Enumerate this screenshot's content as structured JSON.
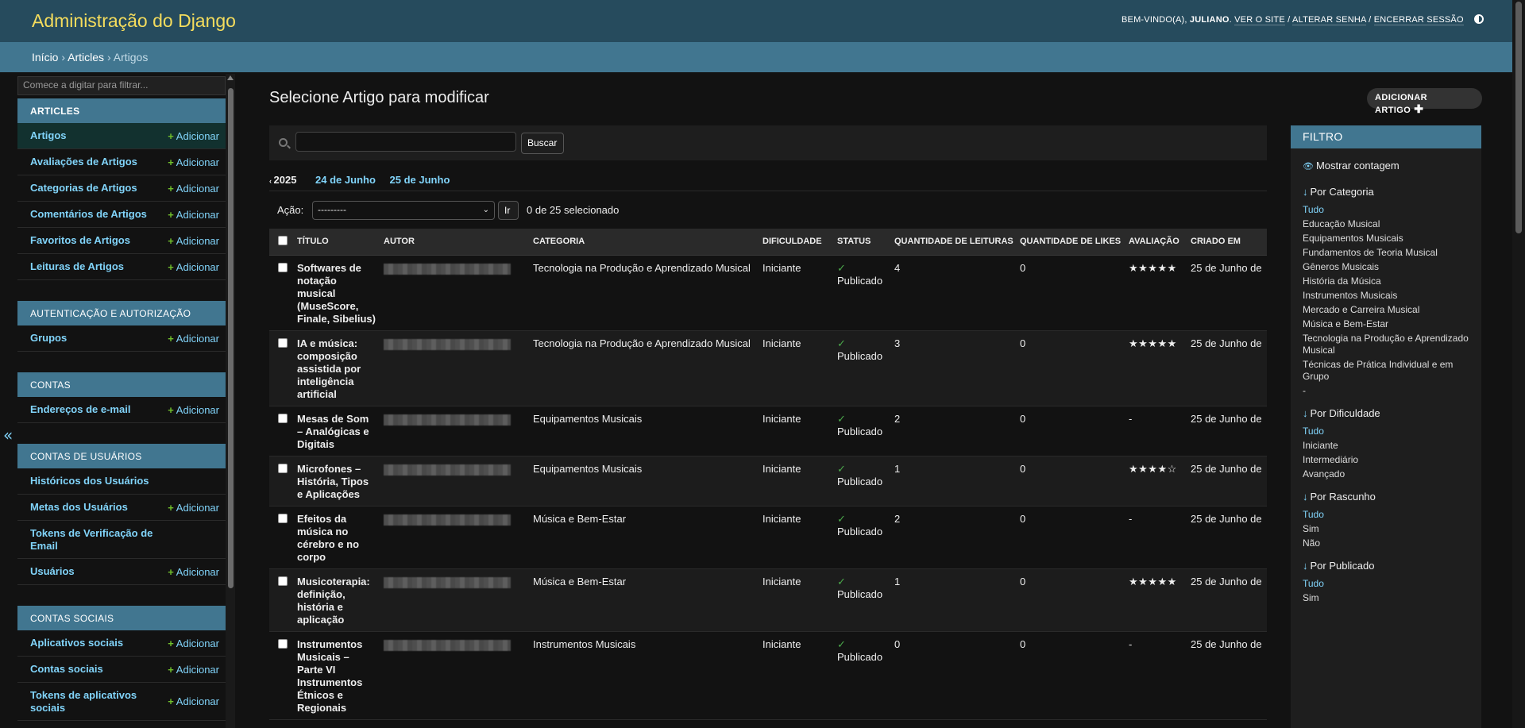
{
  "header": {
    "site_name": "Administração do Django",
    "welcome": "BEM-VINDO(A),",
    "username": "JULIANO",
    "links": [
      "VER O SITE",
      "ALTERAR SENHA",
      "ENCERRAR SESSÃO"
    ]
  },
  "breadcrumbs": {
    "home": "Início",
    "app": "Articles",
    "current": "Artigos",
    "separator": "›"
  },
  "sidebar": {
    "filter_placeholder": "Comece a digitar para filtrar...",
    "add_label": "Adicionar",
    "toggle": "«",
    "apps": [
      {
        "caption": "ARTICLES",
        "models": [
          {
            "name": "Artigos",
            "add": true
          },
          {
            "name": "Avaliações de Artigos",
            "add": true
          },
          {
            "name": "Categorias de Artigos",
            "add": true
          },
          {
            "name": "Comentários de Artigos",
            "add": true
          },
          {
            "name": "Favoritos de Artigos",
            "add": true
          },
          {
            "name": "Leituras de Artigos",
            "add": true
          }
        ]
      },
      {
        "caption": "AUTENTICAÇÃO E AUTORIZAÇÃO",
        "models": [
          {
            "name": "Grupos",
            "add": true
          }
        ]
      },
      {
        "caption": "CONTAS",
        "models": [
          {
            "name": "Endereços de e-mail",
            "add": true
          }
        ]
      },
      {
        "caption": "CONTAS DE USUÁRIOS",
        "models": [
          {
            "name": "Históricos dos Usuários",
            "add": false
          },
          {
            "name": "Metas dos Usuários",
            "add": true
          },
          {
            "name": "Tokens de Verificação de Email",
            "add": false
          },
          {
            "name": "Usuários",
            "add": true
          }
        ]
      },
      {
        "caption": "CONTAS SOCIAIS",
        "models": [
          {
            "name": "Aplicativos sociais",
            "add": true
          },
          {
            "name": "Contas sociais",
            "add": true
          },
          {
            "name": "Tokens de aplicativos sociais",
            "add": true
          }
        ]
      }
    ]
  },
  "content": {
    "title": "Selecione Artigo para modificar",
    "add_button": "ADICIONAR ARTIGO",
    "search_button": "Buscar",
    "date_hierarchy": {
      "back": "2025",
      "links": [
        "24 de Junho",
        "25 de Junho"
      ]
    },
    "actions": {
      "label": "Ação:",
      "selected": "---------",
      "go": "Ir",
      "counter": "0 de 25 selecionado"
    }
  },
  "table": {
    "columns": [
      "TÍTULO",
      "AUTOR",
      "CATEGORIA",
      "DIFICULDADE",
      "STATUS",
      "QUANTIDADE DE LEITURAS",
      "QUANTIDADE DE LIKES",
      "AVALIAÇÃO",
      "CRIADO EM"
    ],
    "rows": [
      {
        "title": "Softwares de notação musical (MuseScore, Finale, Sibelius)",
        "category": "Tecnologia na Produção e Aprendizado Musical",
        "difficulty": "Iniciante",
        "status": "Publicado",
        "reads": "4",
        "likes": "0",
        "rating": "★★★★★",
        "created": "25 de Junho de"
      },
      {
        "title": "IA e música: composição assistida por inteligência artificial",
        "category": "Tecnologia na Produção e Aprendizado Musical",
        "difficulty": "Iniciante",
        "status": "Publicado",
        "reads": "3",
        "likes": "0",
        "rating": "★★★★★",
        "created": "25 de Junho de"
      },
      {
        "title": "Mesas de Som – Analógicas e Digitais",
        "category": "Equipamentos Musicais",
        "difficulty": "Iniciante",
        "status": "Publicado",
        "reads": "2",
        "likes": "0",
        "rating": "-",
        "created": "25 de Junho de"
      },
      {
        "title": "Microfones – História, Tipos e Aplicações",
        "category": "Equipamentos Musicais",
        "difficulty": "Iniciante",
        "status": "Publicado",
        "reads": "1",
        "likes": "0",
        "rating": "★★★★☆",
        "created": "25 de Junho de"
      },
      {
        "title": "Efeitos da música no cérebro e no corpo",
        "category": "Música e Bem-Estar",
        "difficulty": "Iniciante",
        "status": "Publicado",
        "reads": "2",
        "likes": "0",
        "rating": "-",
        "created": "25 de Junho de"
      },
      {
        "title": "Musicoterapia: definição, história e aplicação",
        "category": "Música e Bem-Estar",
        "difficulty": "Iniciante",
        "status": "Publicado",
        "reads": "1",
        "likes": "0",
        "rating": "★★★★★",
        "created": "25 de Junho de"
      },
      {
        "title": "Instrumentos Musicais – Parte VI Instrumentos Étnicos e Regionais",
        "category": "Instrumentos Musicais",
        "difficulty": "Iniciante",
        "status": "Publicado",
        "reads": "0",
        "likes": "0",
        "rating": "-",
        "created": "25 de Junho de"
      }
    ]
  },
  "filter": {
    "header": "FILTRO",
    "show_count": "Mostrar contagem",
    "groups": [
      {
        "title": "Por Categoria",
        "options": [
          "Tudo",
          "Educação Musical",
          "Equipamentos Musicais",
          "Fundamentos de Teoria Musical",
          "Gêneros Musicais",
          "História da Música",
          "Instrumentos Musicais",
          "Mercado e Carreira Musical",
          "Música e Bem-Estar",
          "Tecnologia na Produção e Aprendizado Musical",
          "Técnicas de Prática Individual e em Grupo",
          "-"
        ]
      },
      {
        "title": "Por Dificuldade",
        "options": [
          "Tudo",
          "Iniciante",
          "Intermediário",
          "Avançado"
        ]
      },
      {
        "title": "Por Rascunho",
        "options": [
          "Tudo",
          "Sim",
          "Não"
        ]
      },
      {
        "title": "Por Publicado",
        "options": [
          "Tudo",
          "Sim"
        ]
      }
    ]
  },
  "colors": {
    "header_bg": "#264b5d",
    "breadcrumb_bg": "#417690",
    "brand_yellow": "#f5dd5d",
    "link_blue": "#81d4fa",
    "add_green": "#70bf2b"
  }
}
